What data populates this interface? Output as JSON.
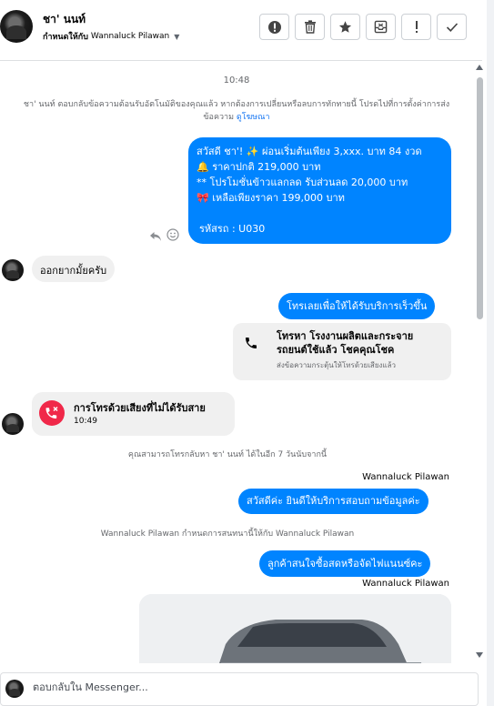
{
  "header": {
    "name": "ชา' นนท์",
    "assigned_label": "กำหนดให้กับ",
    "assigned_to": "Wannaluck Pilawan",
    "toolbar": [
      {
        "icon": "alert-circle-icon"
      },
      {
        "icon": "trash-icon"
      },
      {
        "icon": "star-icon"
      },
      {
        "icon": "archive-icon"
      },
      {
        "icon": "exclamation-icon"
      },
      {
        "icon": "check-icon"
      }
    ]
  },
  "chat": {
    "time1": "10:48",
    "sys1": "ชา' นนท์ ตอบกลับข้อความต้อนรับอัตโนมัติของคุณแล้ว หากต้องการเปลี่ยนหรือลบการทักทายนี้ โปรดไปที่การตั้งค่าการส่งข้อความ",
    "sys1_link": "ดูโฆษณา",
    "ad_message": {
      "line1": "สวัสดี ชา'! ✨  ผ่อนเริ่มต้นเพียง 3,xxx. บาท 84 งวด",
      "line2": "🔔 ราคาปกติ  219,000 บาท",
      "line3": "** โปรโมชั่นข้าวแลกลด รับส่วนลด 20,000 บาท",
      "line4": "🎀  เหลือเพียงราคา 199,000 บาท",
      "line5": "รหัสรถ : U030"
    },
    "in_msg1": "ออกยากมั้ยครับ",
    "out_msg2": "โทรเลยเพื่อให้ได้รับบริการเร็วขึ้น",
    "call_card": {
      "title": "โทรหา โรงงานผลิตและกระจายรถยนต์ใช้แล้ว โชคคุณโชค",
      "subtitle": "ส่งข้อความกระตุ้นให้โทรด้วยเสียงแล้ว"
    },
    "missed_call": {
      "title": "การโทรด้วยเสียงที่ไม่ได้รับสาย",
      "time": "10:49"
    },
    "callback_note": "คุณสามารถโทรกลับหา ชา' นนท์ ได้ในอีก 7 วันนับจากนี้",
    "sender1": "Wannaluck Pilawan",
    "out_msg3": "สวัสดีค่ะ  ยินดีให้บริการสอบถามข้อมูลค่ะ",
    "assign_note": "Wannaluck Pilawan กำหนดการสนทนานี้ให้กับ Wannaluck Pilawan",
    "out_msg4": "ลูกค้าสนใจซื้อสดหรือจัดไฟแนนซ์คะ",
    "sender2": "Wannaluck Pilawan"
  },
  "composer": {
    "placeholder": "ตอบกลับใน Messenger..."
  },
  "colors": {
    "accent": "#0084ff",
    "missed_call": "#f02849",
    "link": "#1877f2"
  }
}
